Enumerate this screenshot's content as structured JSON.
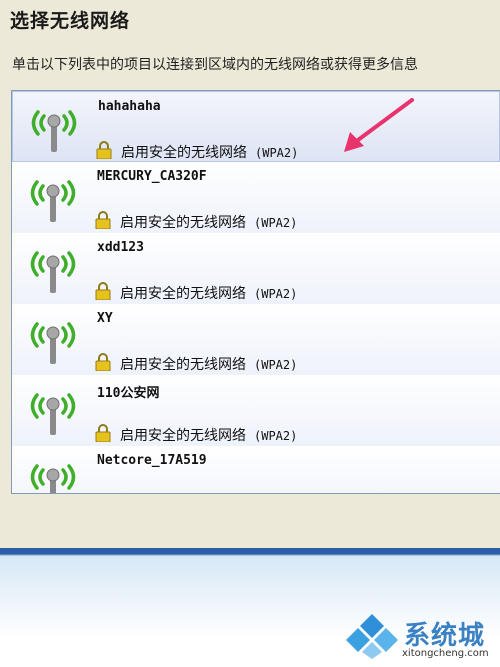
{
  "header": {
    "title": "选择无线网络",
    "description": "单击以下列表中的项目以连接到区域内的无线网络或获得更多信息"
  },
  "networks": [
    {
      "ssid": "hahahaha",
      "security": "启用安全的无线网络",
      "auth": "(WPA2)"
    },
    {
      "ssid": "MERCURY_CA320F",
      "security": "启用安全的无线网络",
      "auth": "(WPA2)"
    },
    {
      "ssid": "xdd123",
      "security": "启用安全的无线网络",
      "auth": "(WPA2)"
    },
    {
      "ssid": "XY",
      "security": "启用安全的无线网络",
      "auth": "(WPA2)"
    },
    {
      "ssid": "110公安网",
      "security": "启用安全的无线网络",
      "auth": "(WPA2)"
    },
    {
      "ssid": "Netcore_17A519",
      "security": "",
      "auth": ""
    }
  ],
  "watermark": {
    "brand": "系统城",
    "url": "xitongcheng.com"
  },
  "icons": {
    "signal": "wireless-signal-icon",
    "lock": "lock-icon",
    "arrow": "pointer-arrow",
    "logo": "windows-logo-icon"
  },
  "colors": {
    "signal_green": "#3fae2a",
    "arrow_pink": "#e8336d",
    "list_border": "#7f9db9"
  }
}
